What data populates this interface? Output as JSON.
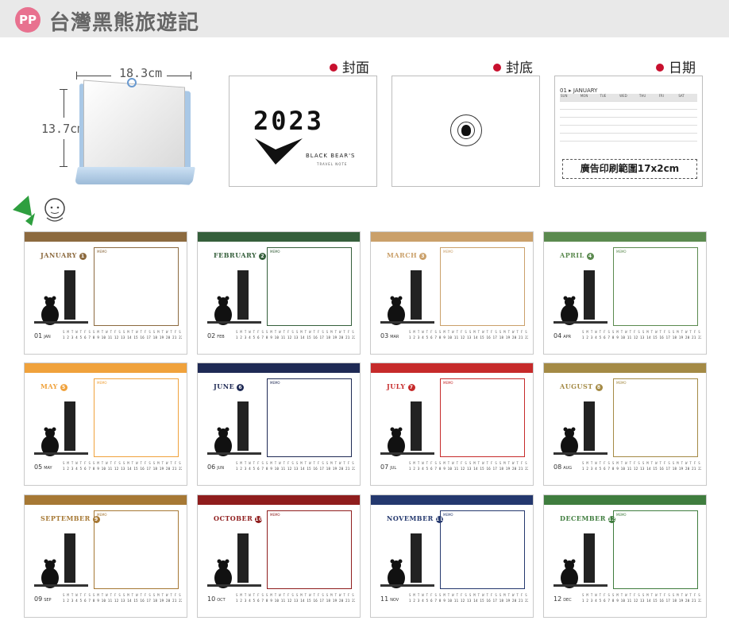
{
  "header": {
    "logo_text": "PP",
    "title": "台灣黑熊旅遊記",
    "logo_color": "#e8718f",
    "bar_color": "#e9e9e9"
  },
  "product": {
    "width_label": "18.3cm",
    "height_label": "13.7cm"
  },
  "previews": {
    "cover": {
      "label": "封面",
      "year_text": "2023",
      "brand": "BLACK BEAR'S",
      "brand_sub": "TRAVEL NOTE"
    },
    "back": {
      "label": "封底"
    },
    "date": {
      "label": "日期",
      "month_header": "01 ▸ JANUARY",
      "weekdays": [
        "SUN",
        "MON",
        "TUE",
        "WED",
        "THU",
        "FRI",
        "SAT"
      ],
      "ad_area": "廣告印刷範圍17x2cm"
    }
  },
  "months": [
    {
      "name": "JANUARY",
      "num": "1",
      "foot_num": "01",
      "foot_abbr": "JAN",
      "color": "#8c6a3f"
    },
    {
      "name": "FEBRUARY",
      "num": "2",
      "foot_num": "02",
      "foot_abbr": "FEB",
      "color": "#355f3b"
    },
    {
      "name": "MARCH",
      "num": "3",
      "foot_num": "03",
      "foot_abbr": "MAR",
      "color": "#caa06a"
    },
    {
      "name": "APRIL",
      "num": "4",
      "foot_num": "04",
      "foot_abbr": "APR",
      "color": "#5b8a4f"
    },
    {
      "name": "MAY",
      "num": "5",
      "foot_num": "05",
      "foot_abbr": "MAY",
      "color": "#f0a23c"
    },
    {
      "name": "JUNE",
      "num": "6",
      "foot_num": "06",
      "foot_abbr": "JUN",
      "color": "#1f2a55"
    },
    {
      "name": "JULY",
      "num": "7",
      "foot_num": "07",
      "foot_abbr": "JUL",
      "color": "#c62a2a"
    },
    {
      "name": "AUGUST",
      "num": "8",
      "foot_num": "08",
      "foot_abbr": "AUG",
      "color": "#a48a45"
    },
    {
      "name": "SEPTEMBER",
      "num": "9",
      "foot_num": "09",
      "foot_abbr": "SEP",
      "color": "#a67834"
    },
    {
      "name": "OCTOBER",
      "num": "10",
      "foot_num": "10",
      "foot_abbr": "OCT",
      "color": "#8f1d1d"
    },
    {
      "name": "NOVEMBER",
      "num": "11",
      "foot_num": "11",
      "foot_abbr": "NOV",
      "color": "#24386e"
    },
    {
      "name": "DECEMBER",
      "num": "12",
      "foot_num": "12",
      "foot_abbr": "DEC",
      "color": "#3f7d3e"
    }
  ],
  "memo_label": "MEMO",
  "weekday_row": "S M T W T F S S M T W T F S S M T W T F S S M T W T F S S M T W T F S S M T W",
  "date_row": "1 2 3 4 5 6 7 8 9 10 11 12 13 14 15 16 17 18 19 20 21 22 23 24 25 26 27 28 29 30 31"
}
